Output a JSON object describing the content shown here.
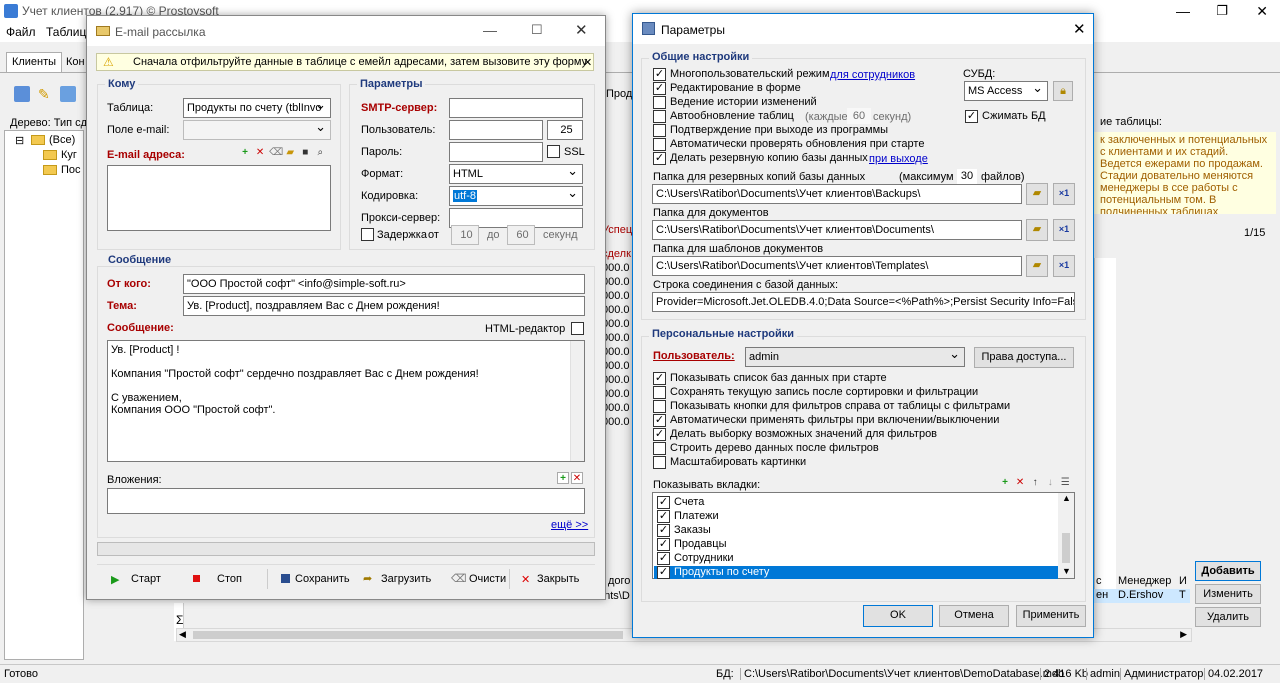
{
  "main": {
    "title": "Учет клиентов (2.917) © Prostoysoft",
    "menu": [
      "Файл",
      "Таблицы"
    ],
    "tabs": [
      "Клиенты",
      "Кон"
    ],
    "tree_label": "Дерево: Тип сд",
    "tree_root": "(Все)",
    "tree_items": [
      "Куг",
      "Пос"
    ],
    "right_label": "ие таблицы:",
    "right_text": "к заключенных и потенциальных с клиентами и их стадий. Ведется ежерами по продажам. Стадии довательно меняются менеджеры в ссе работы с потенциальным том. В подчиненных таблицах",
    "pager": "1/15",
    "col_a": "Успец",
    "col_b": "сделк",
    "cells": [
      "000.0",
      "000.0",
      "000.0",
      "000.0",
      "000.0",
      "000.0",
      "000.0",
      "000.0",
      "000.0",
      "000.0",
      "000.0",
      "000.0"
    ],
    "bottom_cols": [
      "с",
      "Менеджер",
      "И"
    ],
    "bottom_vals": [
      "ен",
      "D.Ershov",
      "Т"
    ],
    "bottom_left_a": "дого",
    "bottom_left_b": "ents\\D",
    "sigma": "Σ",
    "side_buttons": [
      "Добавить",
      "Изменить",
      "Удалить"
    ],
    "product_tab": "Прод"
  },
  "status": {
    "ready": "Готово",
    "db_label": "БД:",
    "db_path": "C:\\Users\\Ratibor\\Documents\\Учет клиентов\\DemoDatabase.mdb",
    "size": "2 416 Kb",
    "user": "admin",
    "role": "Администратор",
    "date": "04.02.2017"
  },
  "email": {
    "title": "E-mail рассылка",
    "hint": "Сначала отфильтруйте данные в таблице с емейл адресами, затем вызовите эту форму",
    "komu": "Кому",
    "table_label": "Таблица:",
    "table_value": "Продукты по счету (tblInvo",
    "field_label": "Поле e-mail:",
    "addr_label": "E-mail адреса:",
    "params": "Параметры",
    "smtp": "SMTP-сервер:",
    "user": "Пользователь:",
    "port": "25",
    "password": "Пароль:",
    "ssl": "SSL",
    "format": "Формат:",
    "format_value": "HTML",
    "encoding": "Кодировка:",
    "encoding_value": "utf-8",
    "proxy": "Прокси-сервер:",
    "delay": "Задержка",
    "from_w": "от",
    "delay_from": "10",
    "to_w": "до",
    "delay_to": "60",
    "sec": "секунд",
    "message": "Сообщение",
    "from_label": "От кого:",
    "from_value": "\"ООО Простой софт\" <info@simple-soft.ru>",
    "subject_label": "Тема:",
    "subject_value": "Ув. [Product], поздравляем Вас с Днем рождения!",
    "msg_label": "Сообщение:",
    "html_editor": "HTML-редактор",
    "body_l1": "Ув. [Product] !",
    "body_l2": "Компания \"Простой софт\" сердечно поздравляет Вас с Днем рождения!",
    "body_l3": "С уважением,",
    "body_l4": "Компания ООО \"Простой софт\".",
    "attach_label": "Вложения:",
    "more": "ещё >>",
    "start": "Старт",
    "stop": "Стоп",
    "save": "Сохранить",
    "load": "Загрузить",
    "clear": "Очисти",
    "close": "Закрыть"
  },
  "params": {
    "title": "Параметры",
    "general": "Общие настройки",
    "multi": "Многопользовательский режим",
    "for_staff": "для сотрудников",
    "edit_form": "Редактирование в форме",
    "history": "Ведение истории изменений",
    "autoupdate": "Автообновление таблиц",
    "every": "(каждые",
    "every_val": "60",
    "seconds": "секунд)",
    "confirm_exit": "Подтверждение при выходе из программы",
    "check_updates": "Автоматически проверять обновления при старте",
    "backup": "Делать резервную копию базы данных",
    "on_exit": "при выходе",
    "dbms": "СУБД:",
    "dbms_value": "MS Access",
    "compress": "Сжимать БД",
    "backup_folder": "Папка для резервных копий базы данных",
    "max": "(максимум",
    "max_val": "30",
    "files": "файлов)",
    "backup_path": "C:\\Users\\Ratibor\\Documents\\Учет клиентов\\Backups\\",
    "docs_folder": "Папка для документов",
    "docs_path": "C:\\Users\\Ratibor\\Documents\\Учет клиентов\\Documents\\",
    "tpl_folder": "Папка для шаблонов документов",
    "tpl_path": "C:\\Users\\Ratibor\\Documents\\Учет клиентов\\Templates\\",
    "conn_label": "Строка соединения с базой данных:",
    "conn_value": "Provider=Microsoft.Jet.OLEDB.4.0;Data Source=<%Path%>;Persist Security Info=False",
    "personal": "Персональные настройки",
    "user_label": "Пользователь:",
    "user_value": "admin",
    "rights": "Права доступа...",
    "opt1": "Показывать список баз данных при старте",
    "opt2": "Сохранять текущую запись после сортировки и фильтрации",
    "opt3": "Показывать кнопки для фильтров справа от таблицы с фильтрами",
    "opt4": "Автоматически применять фильтры при включении/выключении",
    "opt5": "Делать выборку возможных значений для фильтров",
    "opt6": "Строить дерево данных после фильтров",
    "opt7": "Масштабировать картинки",
    "tabs_label": "Показывать вкладки:",
    "tabs": [
      "Счета",
      "Платежи",
      "Заказы",
      "Продавцы",
      "Сотрудники",
      "Продукты по счету"
    ],
    "ok": "OK",
    "cancel": "Отмена",
    "apply": "Применить"
  },
  "colors": {
    "accent": "#1f3a7d",
    "required": "#a80000",
    "selection": "#0078d7",
    "hint_bg": "#ffffe1"
  }
}
